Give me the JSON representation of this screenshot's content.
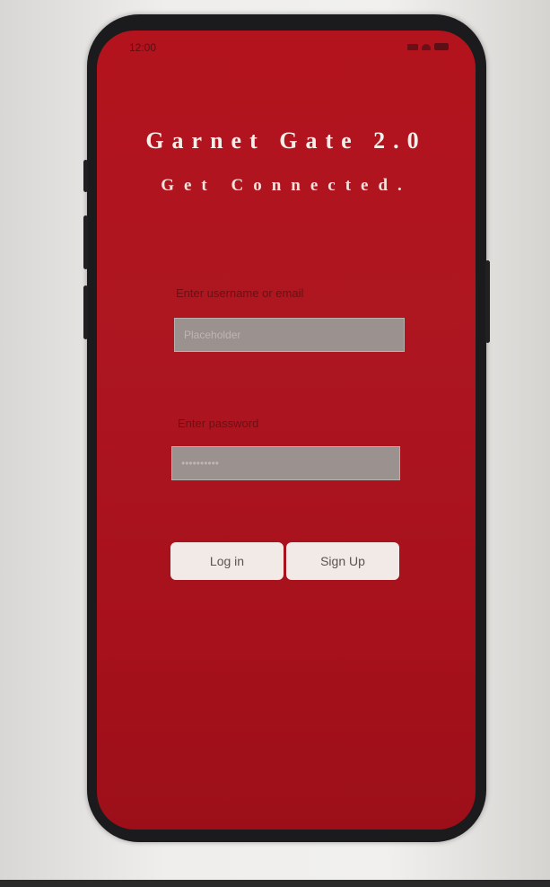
{
  "status_bar": {
    "time": "12:00"
  },
  "app": {
    "title": "Garnet Gate 2.0",
    "subtitle": "Get Connected."
  },
  "login_form": {
    "username_label": "Enter username or email",
    "username_placeholder": "Placeholder",
    "password_label": "Enter password",
    "password_placeholder": "••••••••••",
    "login_label": "Log in",
    "signup_label": "Sign Up"
  },
  "colors": {
    "screen_red": "#ad1620",
    "field_grey": "#9b918f",
    "button_light": "#f1eae7",
    "title_white": "#f6efe9"
  },
  "icons": [
    "signal-icon",
    "wifi-icon",
    "battery-icon"
  ]
}
